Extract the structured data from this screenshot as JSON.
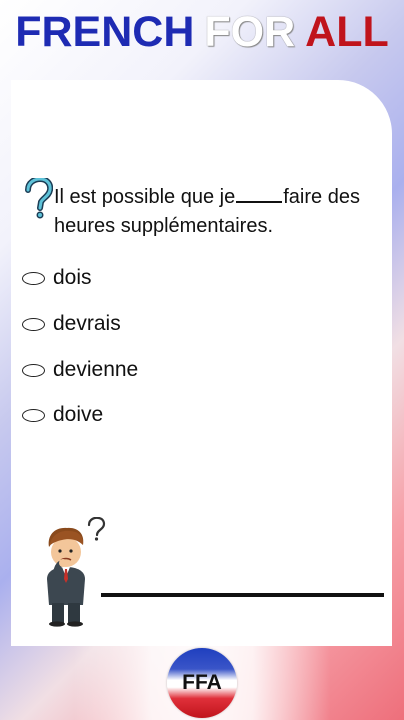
{
  "header": {
    "word1": "FRENCH",
    "word2": "FOR",
    "word3": "ALL"
  },
  "quiz": {
    "question_part1": "Il est possible que je",
    "question_part2": "faire des heures supplémentaires.",
    "options": [
      "dois",
      "devrais",
      "devienne",
      "doive"
    ]
  },
  "footer": {
    "badge_text": "FFA"
  },
  "colors": {
    "blue": "#1e2bb3",
    "red": "#c0141c",
    "white": "#ffffff"
  }
}
